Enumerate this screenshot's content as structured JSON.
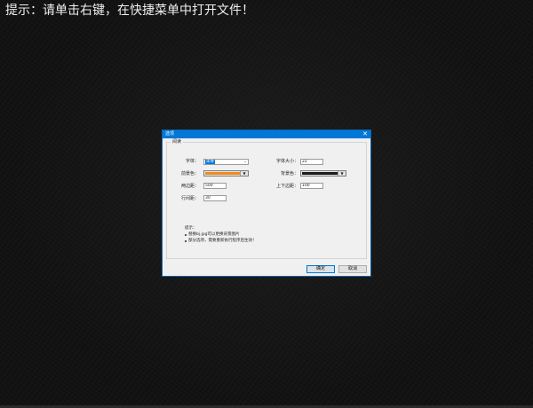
{
  "page": {
    "hint": "提示：请单击右键，在快捷菜单中打开文件！"
  },
  "dialog": {
    "title": "选项",
    "close_glyph": "✕",
    "group_title": "阅读",
    "fields": {
      "font_label": "字体：",
      "font_value": "宋体",
      "font_size_label": "字体大小：",
      "font_size_value": "22",
      "fg_color_label": "前景色：",
      "fg_color": "#f08a1a",
      "bg_color_label": "背景色：",
      "bg_color": "#1a1a1a",
      "h_margin_label": "两边距：",
      "h_margin_value": "500",
      "v_margin_label": "上下边距：",
      "v_margin_value": "100",
      "line_spacing_label": "行间距：",
      "line_spacing_value": "30"
    },
    "tips": {
      "heading": "提示：",
      "items": [
        "替换bj.jpg可以更换背景图片",
        "部分选项，需要重新执行程序后生效！"
      ]
    },
    "buttons": {
      "ok": "确定",
      "cancel": "取消"
    }
  },
  "colors": {
    "titlebar": "#0078d7",
    "dialog_bg": "#f0f0f0",
    "page_bg": "#121212"
  },
  "icons": {
    "combo_arrow": "chevron-down-icon",
    "picker_arrow": "triangle-down-icon",
    "close": "close-icon"
  }
}
